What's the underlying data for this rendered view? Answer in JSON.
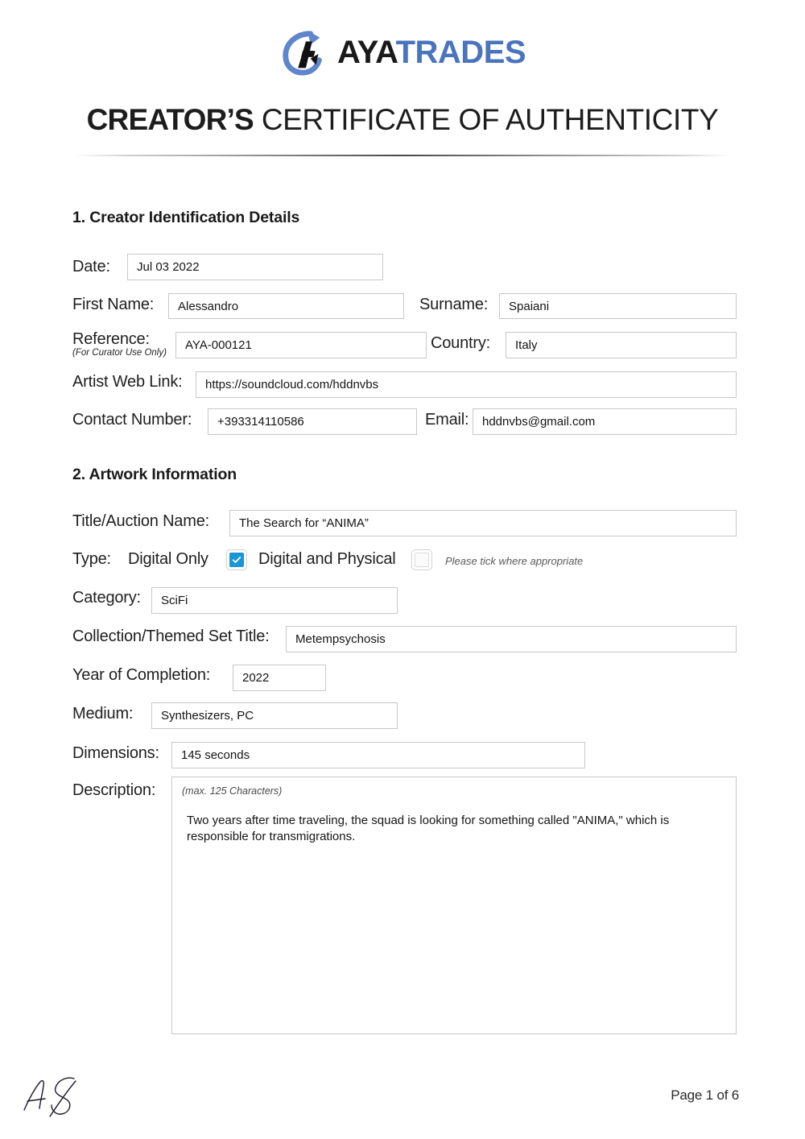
{
  "brand": {
    "name_primary": "AYA",
    "name_secondary": "TRADES",
    "mark_icon": "ayatrades-arrow-logo-icon",
    "color_primary": "#1a1a1a",
    "color_secondary": "#4a74bd"
  },
  "document": {
    "title_bold": "CREATOR’S",
    "title_light": "CERTIFICATE OF AUTHENTICITY"
  },
  "section1": {
    "heading": "1. Creator Identification Details",
    "fields": {
      "date_label": "Date:",
      "date_value": "Jul 03 2022",
      "first_name_label": "First Name:",
      "first_name_value": "Alessandro",
      "surname_label": "Surname:",
      "surname_value": "Spaiani",
      "reference_label": "Reference:",
      "reference_sub_label": "(For Curator Use Only)",
      "reference_value": "AYA-000121",
      "country_label": "Country:",
      "country_value": "Italy",
      "web_link_label": "Artist Web Link:",
      "web_link_value": "https://soundcloud.com/hddnvbs",
      "contact_label": "Contact Number:",
      "contact_value": "+393314110586",
      "email_label": "Email:",
      "email_value": "hddnvbs@gmail.com"
    }
  },
  "section2": {
    "heading": "2. Artwork Information",
    "fields": {
      "title_label": "Title/Auction Name:",
      "title_value": "The Search for “ANIMA”",
      "type_label": "Type:",
      "type_option_digital": "Digital Only",
      "type_option_digital_physical": "Digital and Physical",
      "type_hint": "Please tick where appropriate",
      "type_digital_checked": true,
      "type_digital_physical_checked": false,
      "category_label": "Category:",
      "category_value": "SciFi",
      "collection_label": "Collection/Themed Set Title:",
      "collection_value": "Metempsychosis",
      "year_label": "Year of Completion:",
      "year_value": "2022",
      "medium_label": "Medium:",
      "medium_value": "Synthesizers, PC",
      "dimensions_label": "Dimensions:",
      "dimensions_value": "145 seconds",
      "description_label": "Description:",
      "description_hint": "(max. 125 Characters)",
      "description_value": "Two years after time traveling, the squad is looking for something called \"ANIMA,\" which is responsible for transmigrations."
    }
  },
  "footer": {
    "signature_icon": "handwritten-signature-icon",
    "signature_initials": "AS",
    "page_indicator": "Page 1 of 6"
  }
}
